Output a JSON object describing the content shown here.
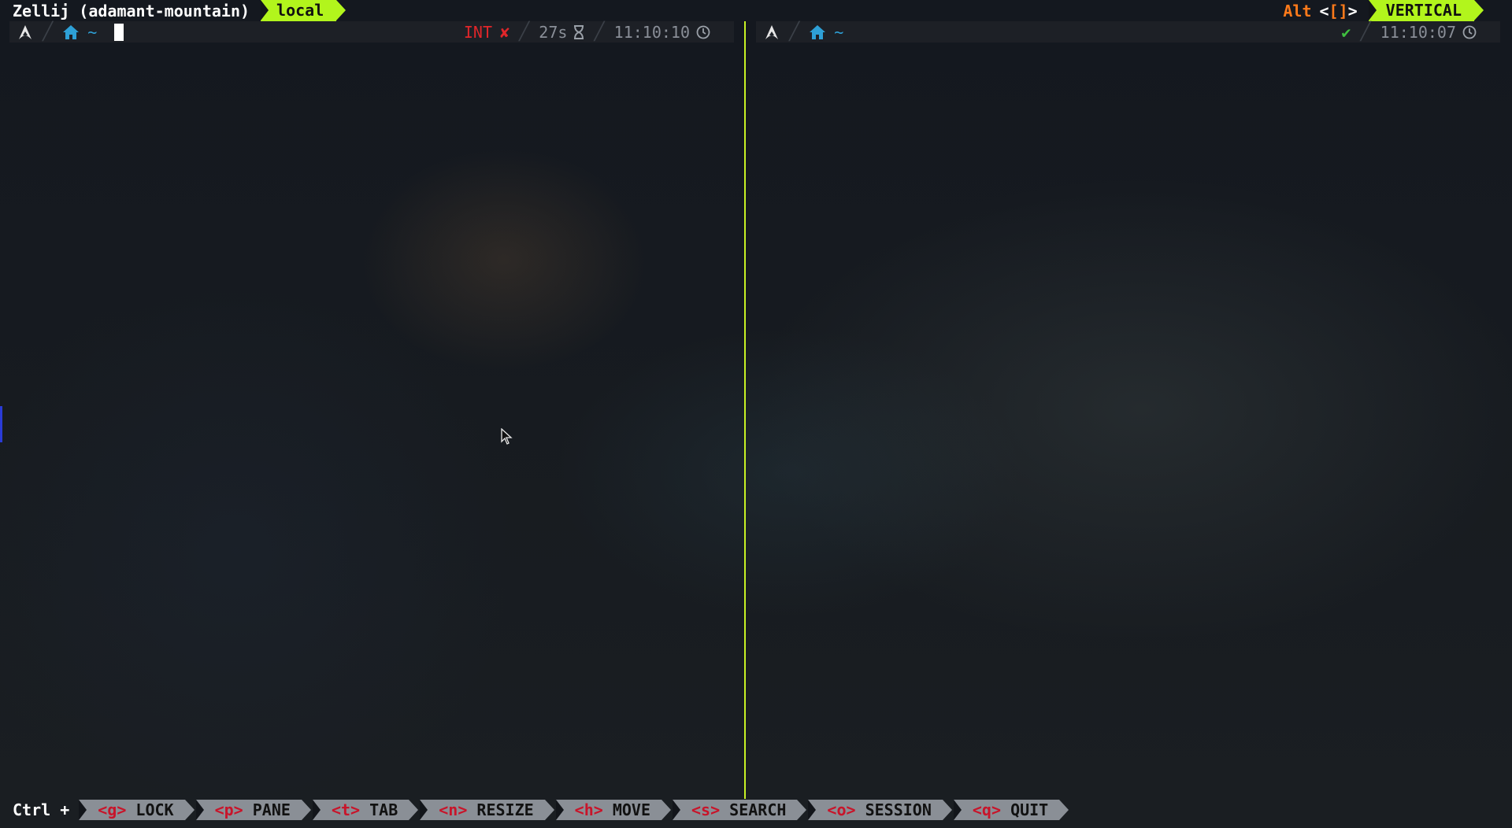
{
  "topbar": {
    "session_title": "Zellij (adamant-mountain)",
    "active_tab": "local",
    "alt_label": "Alt",
    "alt_keys_open": "<",
    "alt_keys_brackets": "[]",
    "alt_keys_close": ">",
    "layout_mode": "VERTICAL"
  },
  "left_pane": {
    "home_path": "~",
    "status": "INT",
    "status_mark": "✘",
    "duration": "27s",
    "time": "11:10:10"
  },
  "right_pane": {
    "home_path": "~",
    "status_mark": "✔",
    "time": "11:10:07"
  },
  "bottombar": {
    "ctrl_label": "Ctrl +",
    "keys": [
      {
        "key": "<g>",
        "label": "LOCK"
      },
      {
        "key": "<p>",
        "label": "PANE"
      },
      {
        "key": "<t>",
        "label": "TAB"
      },
      {
        "key": "<n>",
        "label": "RESIZE"
      },
      {
        "key": "<h>",
        "label": "MOVE"
      },
      {
        "key": "<s>",
        "label": "SEARCH"
      },
      {
        "key": "<o>",
        "label": "SESSION"
      },
      {
        "key": "<q>",
        "label": "QUIT"
      }
    ]
  },
  "colors": {
    "accent_green": "#b2f51c",
    "alt_orange": "#ff7a1a",
    "error_red": "#e0262a",
    "path_blue": "#2ea0d6",
    "ok_green": "#3fbf3f",
    "divider": "#c8f224"
  },
  "icons": {
    "os": "arch-linux-icon",
    "home": "home-icon",
    "duration": "hourglass-icon",
    "time": "clock-icon"
  }
}
